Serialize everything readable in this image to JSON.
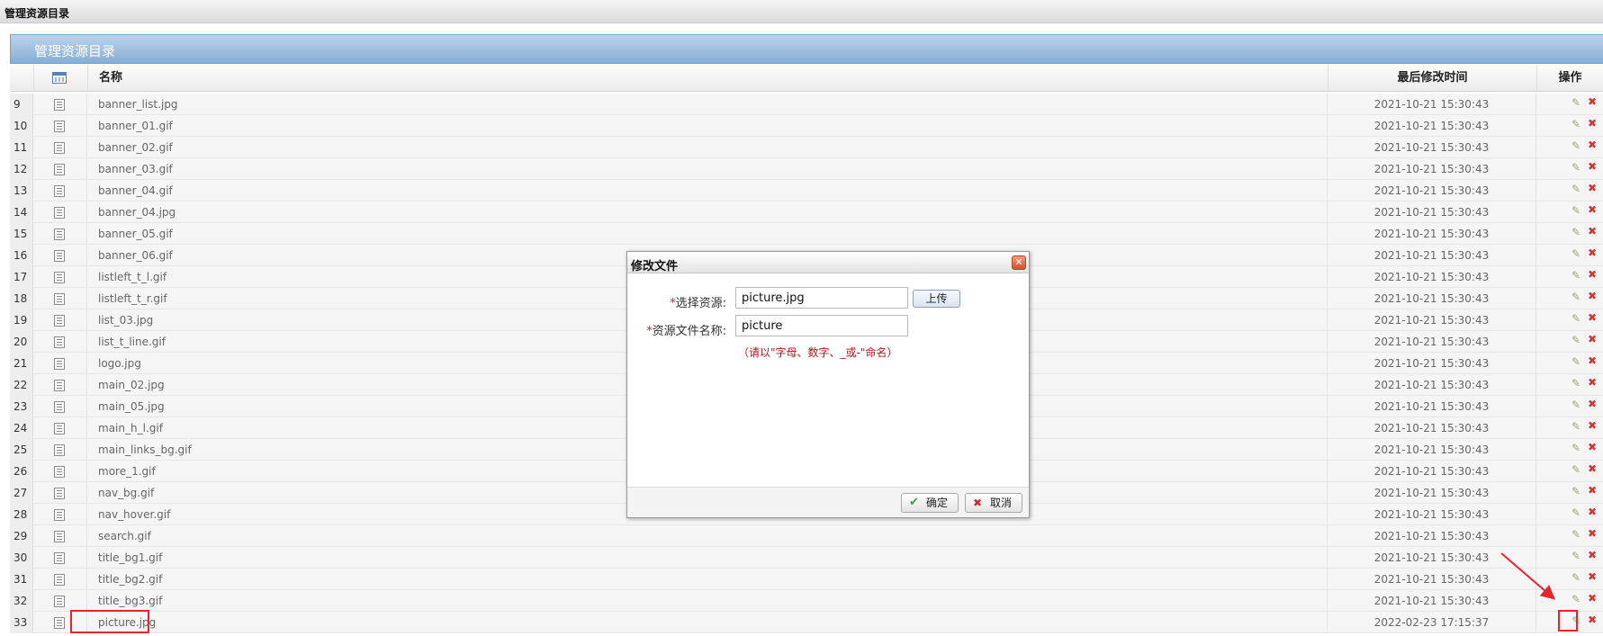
{
  "window": {
    "title": "管理资源目录"
  },
  "panel": {
    "title": "管理资源目录"
  },
  "columns": {
    "name": "名称",
    "modified": "最后修改时间",
    "actions": "操作"
  },
  "colors": {
    "accent": "#88aed5",
    "highlight": "#e8262a",
    "required": "#d51d1d"
  },
  "icons": {
    "header": "calendar-icon",
    "row": "document-icon",
    "edit": "pencil-icon",
    "delete": "x-icon",
    "dialog_close": "close-icon",
    "ok": "check-icon",
    "cancel": "cancel-icon"
  },
  "rows": [
    {
      "no": "9",
      "name": "banner_list.jpg",
      "time": "2021-10-21 15:30:43"
    },
    {
      "no": "10",
      "name": "banner_01.gif",
      "time": "2021-10-21 15:30:43"
    },
    {
      "no": "11",
      "name": "banner_02.gif",
      "time": "2021-10-21 15:30:43"
    },
    {
      "no": "12",
      "name": "banner_03.gif",
      "time": "2021-10-21 15:30:43"
    },
    {
      "no": "13",
      "name": "banner_04.gif",
      "time": "2021-10-21 15:30:43"
    },
    {
      "no": "14",
      "name": "banner_04.jpg",
      "time": "2021-10-21 15:30:43"
    },
    {
      "no": "15",
      "name": "banner_05.gif",
      "time": "2021-10-21 15:30:43"
    },
    {
      "no": "16",
      "name": "banner_06.gif",
      "time": "2021-10-21 15:30:43"
    },
    {
      "no": "17",
      "name": "listleft_t_l.gif",
      "time": "2021-10-21 15:30:43"
    },
    {
      "no": "18",
      "name": "listleft_t_r.gif",
      "time": "2021-10-21 15:30:43"
    },
    {
      "no": "19",
      "name": "list_03.jpg",
      "time": "2021-10-21 15:30:43"
    },
    {
      "no": "20",
      "name": "list_t_line.gif",
      "time": "2021-10-21 15:30:43"
    },
    {
      "no": "21",
      "name": "logo.jpg",
      "time": "2021-10-21 15:30:43"
    },
    {
      "no": "22",
      "name": "main_02.jpg",
      "time": "2021-10-21 15:30:43"
    },
    {
      "no": "23",
      "name": "main_05.jpg",
      "time": "2021-10-21 15:30:43"
    },
    {
      "no": "24",
      "name": "main_h_l.gif",
      "time": "2021-10-21 15:30:43"
    },
    {
      "no": "25",
      "name": "main_links_bg.gif",
      "time": "2021-10-21 15:30:43"
    },
    {
      "no": "26",
      "name": "more_1.gif",
      "time": "2021-10-21 15:30:43"
    },
    {
      "no": "27",
      "name": "nav_bg.gif",
      "time": "2021-10-21 15:30:43"
    },
    {
      "no": "28",
      "name": "nav_hover.gif",
      "time": "2021-10-21 15:30:43"
    },
    {
      "no": "29",
      "name": "search.gif",
      "time": "2021-10-21 15:30:43"
    },
    {
      "no": "30",
      "name": "title_bg1.gif",
      "time": "2021-10-21 15:30:43"
    },
    {
      "no": "31",
      "name": "title_bg2.gif",
      "time": "2021-10-21 15:30:43"
    },
    {
      "no": "32",
      "name": "title_bg3.gif",
      "time": "2021-10-21 15:30:43"
    },
    {
      "no": "33",
      "name": "picture.jpg",
      "time": "2022-02-23 17:15:37"
    }
  ],
  "dialog": {
    "title": "修改文件",
    "required_mark": "*",
    "resource_label": "选择资源:",
    "resource_value": "picture.jpg",
    "upload_label": "上传",
    "name_label": "资源文件名称:",
    "name_value": "picture",
    "hint": "（请以\"字母、数字、_或-\"命名）",
    "ok_label": "确定",
    "cancel_label": "取消"
  }
}
